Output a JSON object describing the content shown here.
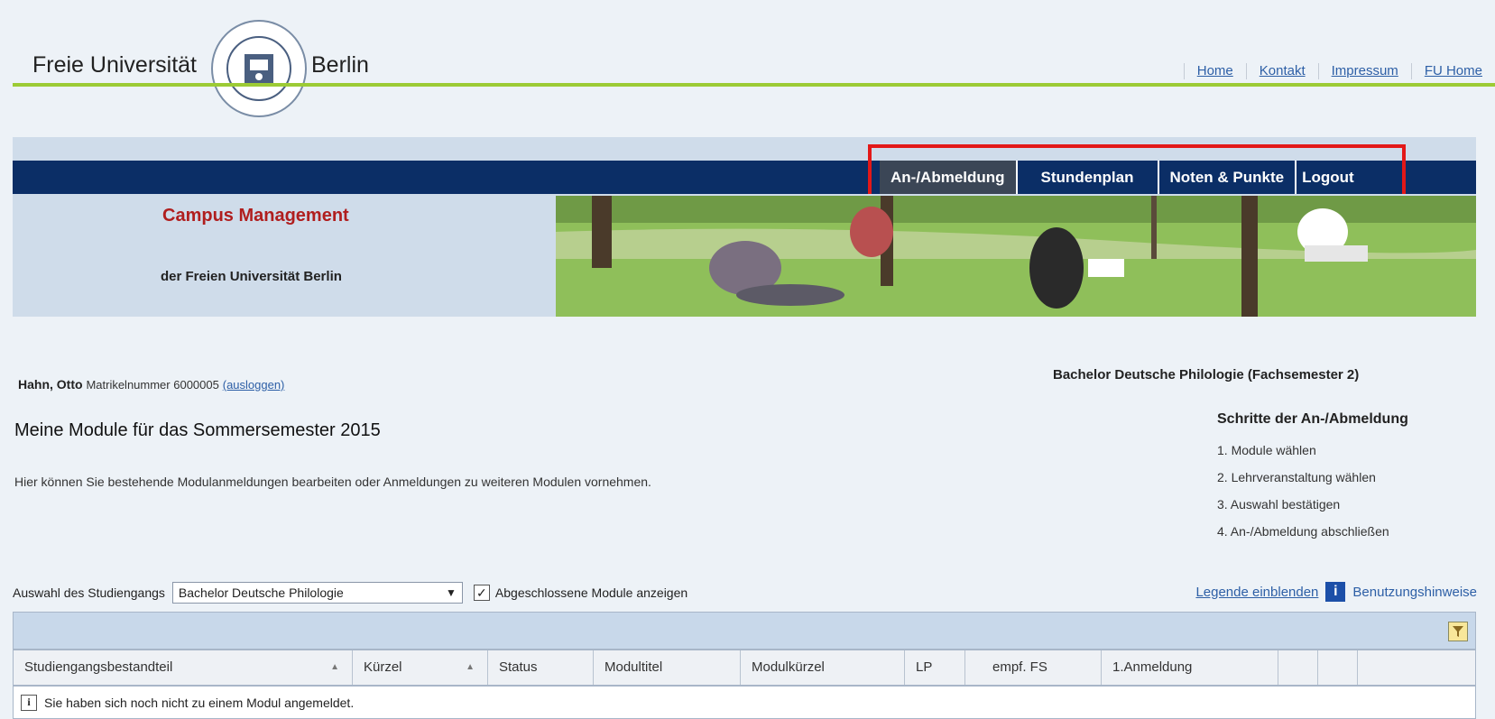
{
  "header": {
    "brand_left": "Freie Universität",
    "brand_right": "Berlin",
    "links": [
      "Home",
      "Kontakt",
      "Impressum",
      "FU Home"
    ]
  },
  "nav": {
    "items": [
      {
        "label": "An-/Abmeldung",
        "active": true
      },
      {
        "label": "Stundenplan",
        "active": false
      },
      {
        "label": "Noten & Punkte",
        "active": false
      },
      {
        "label": "Logout",
        "active": false
      }
    ],
    "highlight_color": "#e31818",
    "bar_color": "#0b2e66"
  },
  "banner": {
    "title": "Campus Management",
    "subtitle": "der Freien Universität Berlin"
  },
  "user": {
    "name": "Hahn, Otto",
    "id_label": "Matrikelnummer 6000005",
    "logout_link": "(ausloggen)"
  },
  "program": "Bachelor Deutsche Philologie (Fachsemester 2)",
  "page_title": "Meine Module für das Sommersemester 2015",
  "intro": "Hier können Sie bestehende Modulanmeldungen bearbeiten oder Anmeldungen zu weiteren Modulen vornehmen.",
  "steps": {
    "heading": "Schritte der An-/Abmeldung",
    "items": [
      "1. Module wählen",
      "2. Lehrveranstaltung wählen",
      "3. Auswahl bestätigen",
      "4. An-/Abmeldung abschließen"
    ]
  },
  "selection": {
    "label": "Auswahl des Studiengangs",
    "selected": "Bachelor Deutsche Philologie",
    "checkbox_checked": true,
    "checkbox_label": "Abgeschlossene Module anzeigen"
  },
  "legend": {
    "show_legend": "Legende einblenden",
    "help": "Benutzungshinweise",
    "info_glyph": "i"
  },
  "table": {
    "columns": [
      "Studiengangsbestandteil",
      "Kürzel",
      "Status",
      "Modultitel",
      "Modulkürzel",
      "LP",
      "empf. FS",
      "1.Anmeldung",
      "",
      ""
    ],
    "empty_message": "Sie haben sich noch nicht zu einem Modul angemeldet."
  }
}
